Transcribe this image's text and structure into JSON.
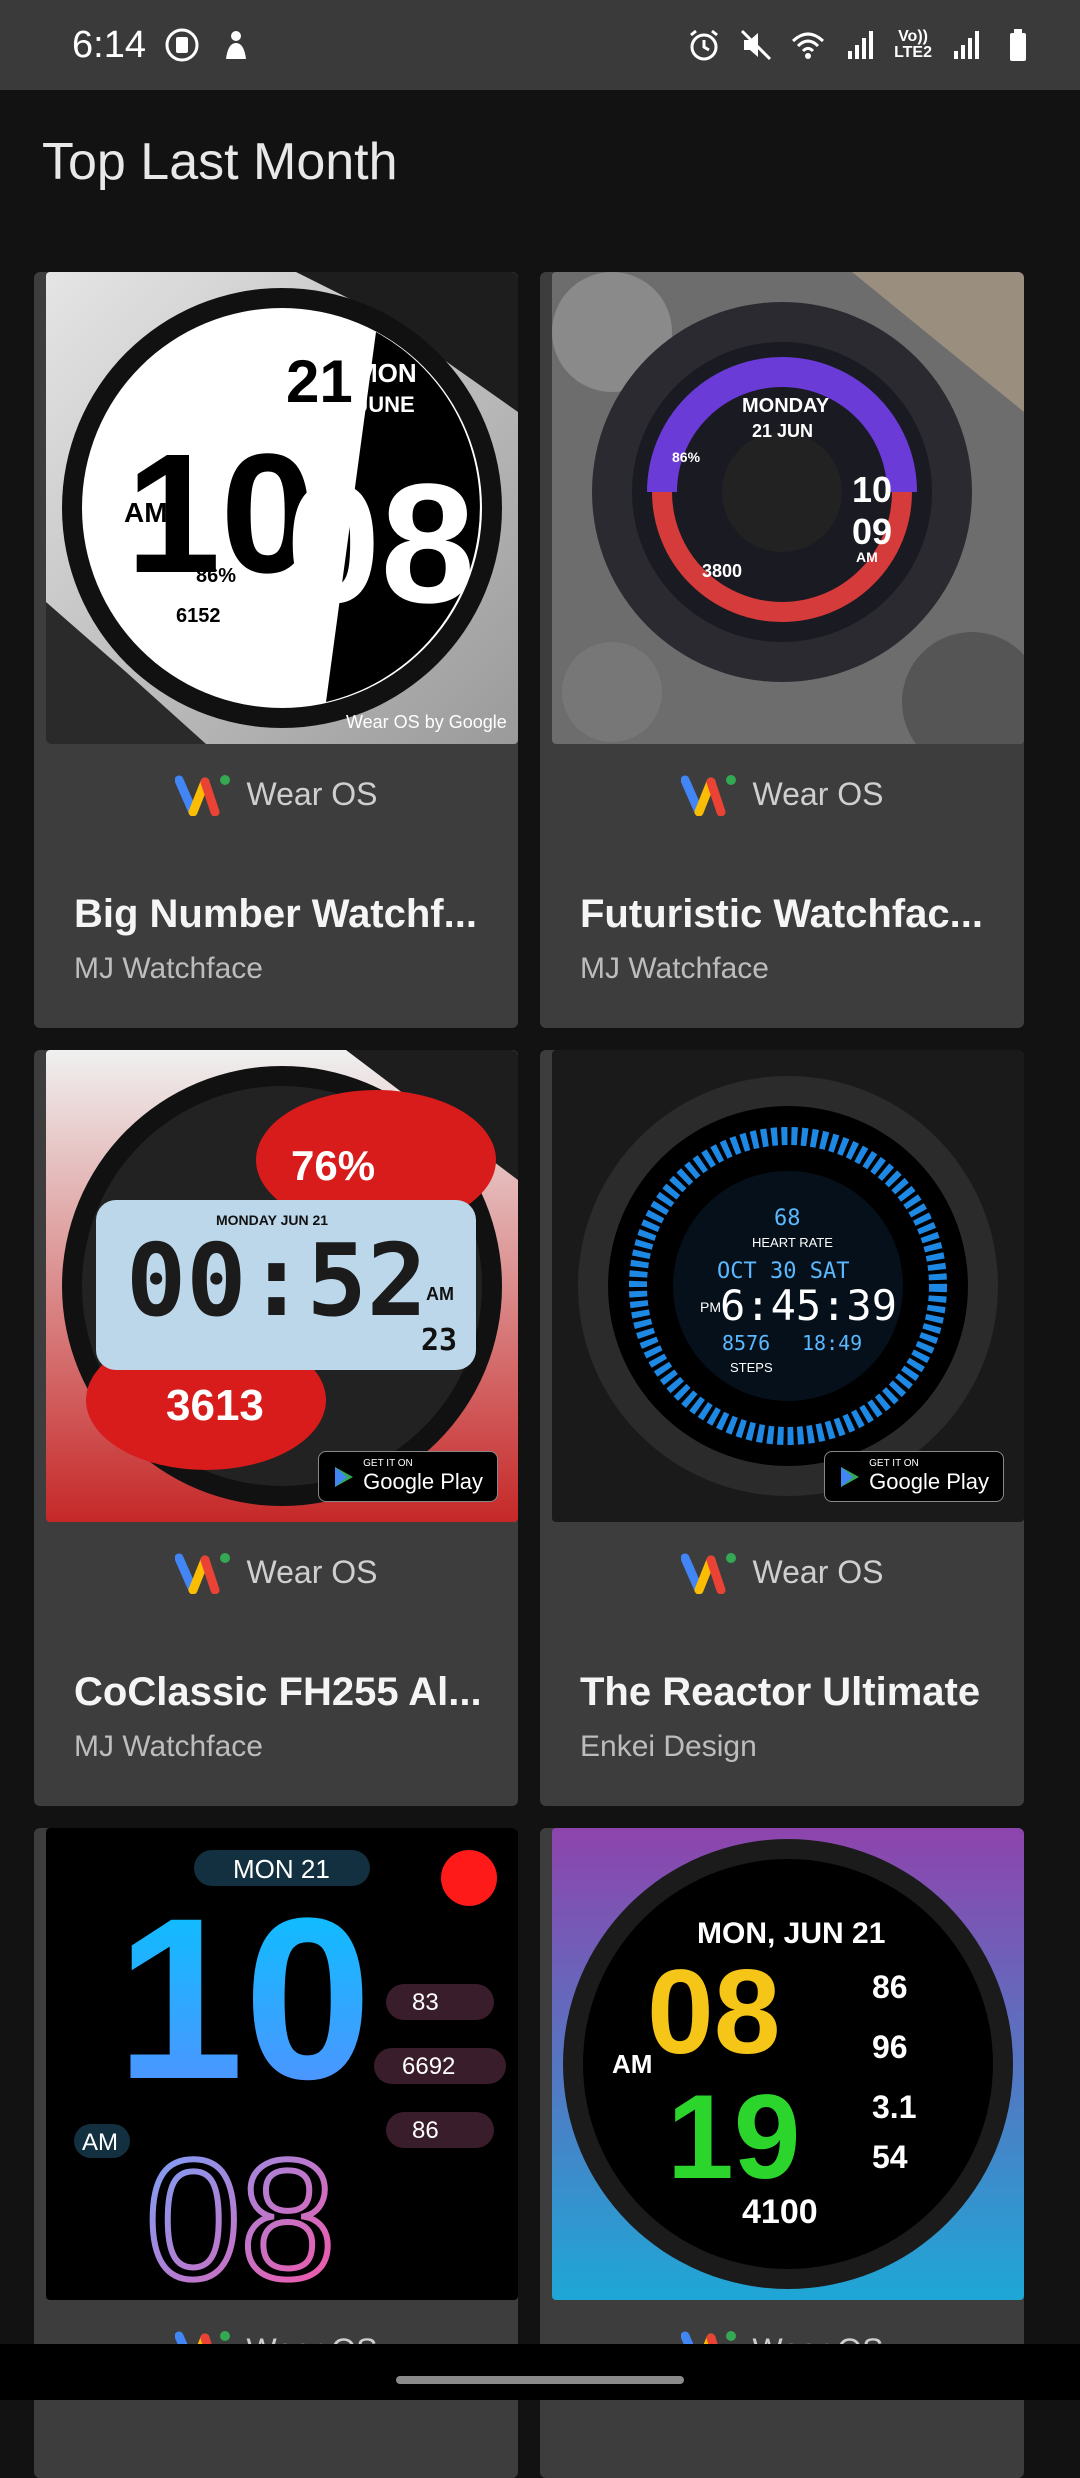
{
  "status_bar": {
    "time": "6:14",
    "net_label_top": "Vo))",
    "net_label_bottom": "LTE2",
    "icons": [
      "notification-icon",
      "person-icon",
      "alarm-icon",
      "mute-icon",
      "wifi-icon",
      "signal-icon",
      "signal-icon-2",
      "battery-icon"
    ]
  },
  "header": {
    "title": "Top Last Month"
  },
  "cards": [
    {
      "title": "Big Number Watchf...",
      "developer": "MJ Watchface",
      "platform": "Wear OS",
      "image_text": {
        "time_hh": "10",
        "time_mm": "08",
        "day": "21",
        "dow": "MON",
        "month": "JUNE",
        "ampm": "AM",
        "battery": "86%",
        "steps": "6152",
        "brand": "Wear OS by Google"
      }
    },
    {
      "title": "Futuristic Watchfac...",
      "developer": "MJ Watchface",
      "platform": "Wear OS",
      "image_text": {
        "dow": "MONDAY",
        "date": "21 JUN",
        "hh": "10",
        "mm": "09",
        "ampm": "AM",
        "battery": "86%",
        "steps": "3800"
      }
    },
    {
      "title": "CoClassic FH255 Al...",
      "developer": "MJ Watchface",
      "platform": "Wear OS",
      "image_text": {
        "battery": "76%",
        "date_line": "MONDAY JUN 21",
        "time": "00:52",
        "ampm": "AM",
        "sec": "23",
        "steps": "3613",
        "badge_small": "GET IT ON",
        "badge_big": "Google Play"
      }
    },
    {
      "title": "The Reactor Ultimate",
      "developer": "Enkei Design",
      "platform": "Wear OS",
      "image_text": {
        "hr": "68",
        "hr_label": "HEART RATE",
        "date": "OCT 30 SAT",
        "ampm": "PM",
        "time": "6:45:39",
        "steps": "8576",
        "time2": "18:49",
        "steps_label": "STEPS",
        "badge_small": "GET IT ON",
        "badge_big": "Google Play"
      }
    },
    {
      "title": "",
      "developer": "",
      "platform": "Wear OS",
      "image_text": {
        "date": "MON 21",
        "hh": "10",
        "mm": "08",
        "ampm": "AM",
        "hr": "83",
        "steps": "6692",
        "battery": "86"
      }
    },
    {
      "title": "",
      "developer": "",
      "platform": "Wear OS",
      "image_text": {
        "date": "MON, JUN 21",
        "hh": "08",
        "mm": "19",
        "ampm": "AM",
        "v1": "86",
        "v2": "96",
        "v3": "3.1",
        "v4": "54",
        "steps": "4100"
      }
    }
  ],
  "colors": {
    "background": "#121212",
    "card": "#3d3d3d",
    "status_bar": "#3a3a3a"
  }
}
